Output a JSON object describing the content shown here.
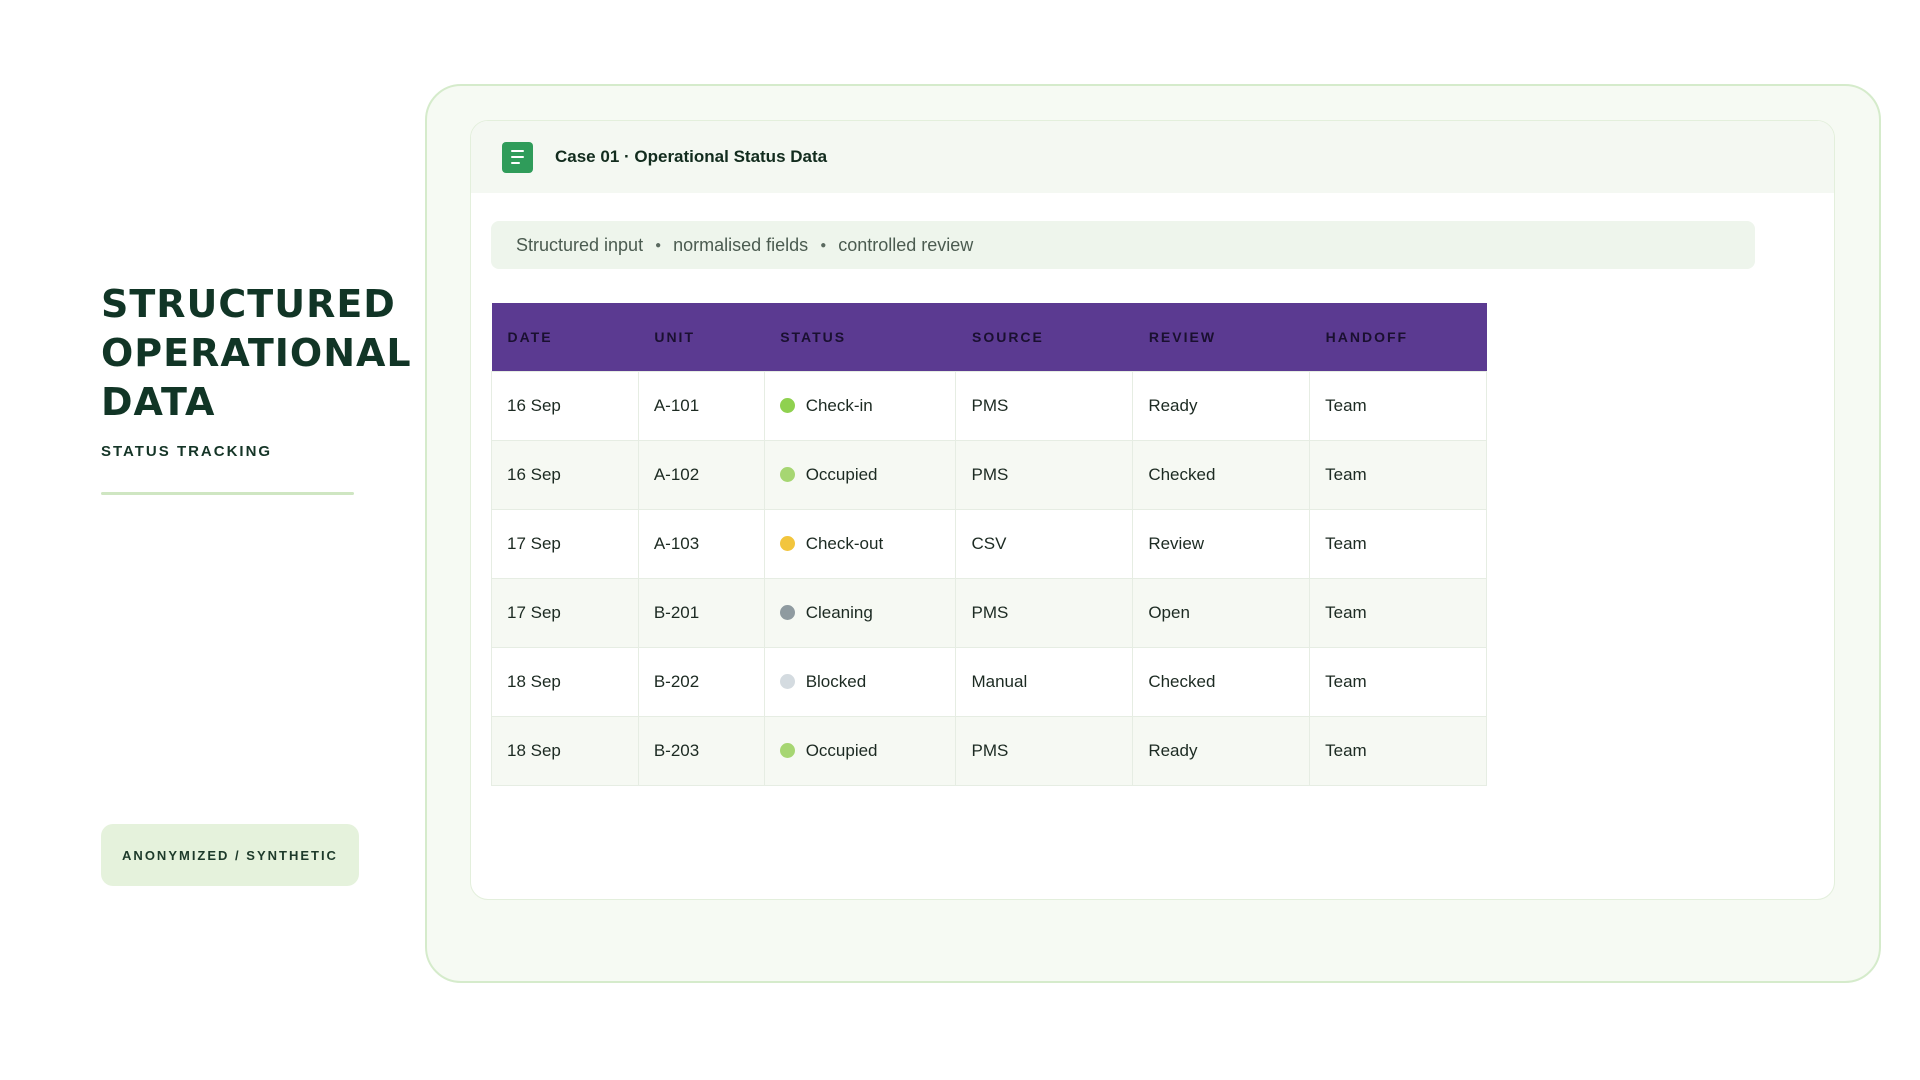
{
  "left": {
    "title": "STRUCTURED OPERATIONAL DATA",
    "subtitle": "STATUS TRACKING",
    "badge": "ANONYMIZED / SYNTHETIC"
  },
  "card": {
    "icon": "document-icon",
    "title": "Case 01 · Operational Status Data",
    "pill": [
      "Structured input",
      "normalised fields",
      "controlled review"
    ]
  },
  "table": {
    "headers": [
      "DATE",
      "UNIT",
      "STATUS",
      "SOURCE",
      "REVIEW",
      "HANDOFF"
    ],
    "rows": [
      {
        "date": "16 Sep",
        "unit": "A-101",
        "status": "Check-in",
        "status_color": "#8fd14f",
        "source": "PMS",
        "review": "Ready",
        "handoff": "Team"
      },
      {
        "date": "16 Sep",
        "unit": "A-102",
        "status": "Occupied",
        "status_color": "#a6d672",
        "source": "PMS",
        "review": "Checked",
        "handoff": "Team"
      },
      {
        "date": "17 Sep",
        "unit": "A-103",
        "status": "Check-out",
        "status_color": "#f2c53d",
        "source": "CSV",
        "review": "Review",
        "handoff": "Team"
      },
      {
        "date": "17 Sep",
        "unit": "B-201",
        "status": "Cleaning",
        "status_color": "#8f9ba0",
        "source": "PMS",
        "review": "Open",
        "handoff": "Team"
      },
      {
        "date": "18 Sep",
        "unit": "B-202",
        "status": "Blocked",
        "status_color": "#d4dbe0",
        "source": "Manual",
        "review": "Checked",
        "handoff": "Team"
      },
      {
        "date": "18 Sep",
        "unit": "B-203",
        "status": "Occupied",
        "status_color": "#a6d672",
        "source": "PMS",
        "review": "Ready",
        "handoff": "Team"
      }
    ]
  },
  "colors": {
    "accent": "#5b3a91",
    "brand_green": "#2f9c5a",
    "title_dark": "#113526"
  }
}
